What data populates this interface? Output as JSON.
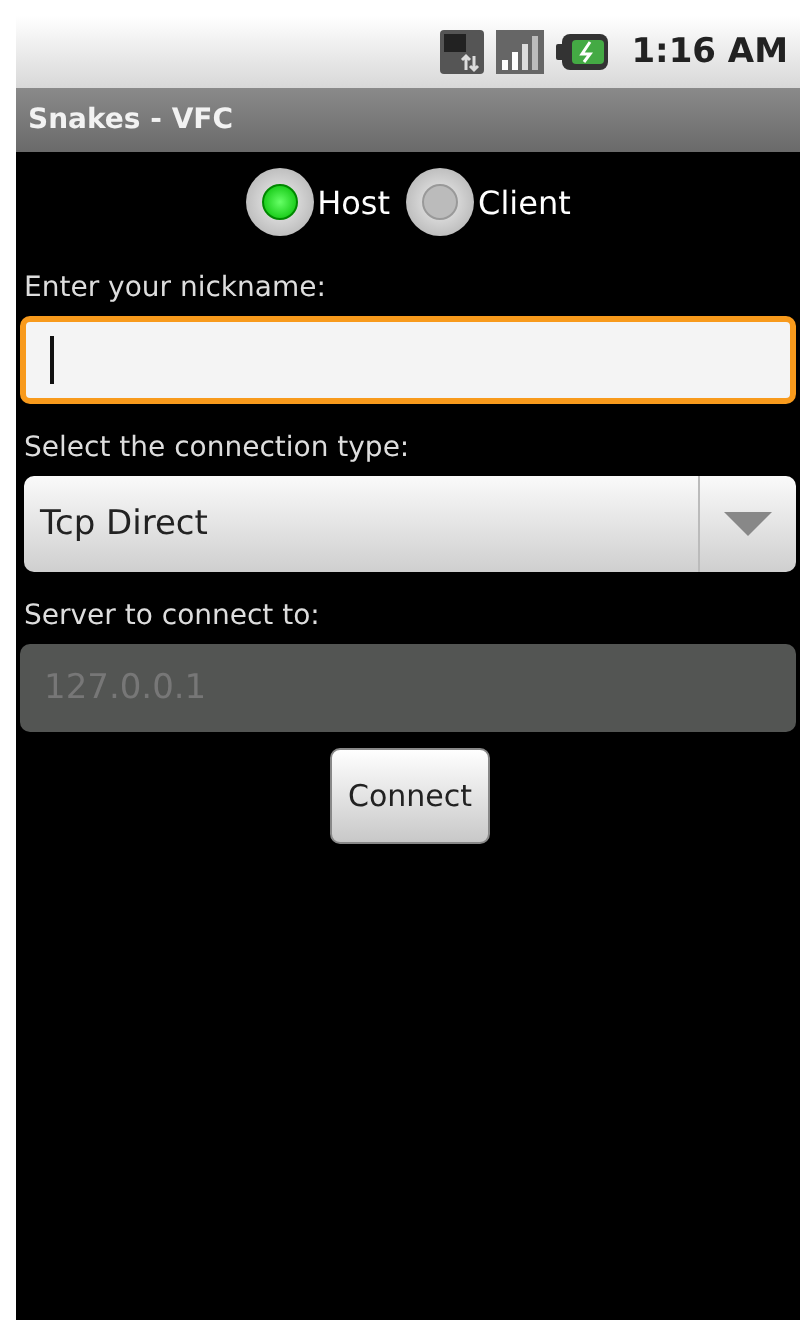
{
  "status_bar": {
    "time": "1:16 AM"
  },
  "title": "Snakes - VFC",
  "role_options": [
    {
      "label": "Host",
      "selected": true
    },
    {
      "label": "Client",
      "selected": false
    }
  ],
  "nickname": {
    "label": "Enter your nickname:",
    "focused": true
  },
  "connection_type": {
    "label": "Select the connection type:",
    "value": "Tcp Direct"
  },
  "server": {
    "label": "Server to connect to:",
    "value": "127.0.0.1",
    "disabled": true
  },
  "connect_button": "Connect"
}
